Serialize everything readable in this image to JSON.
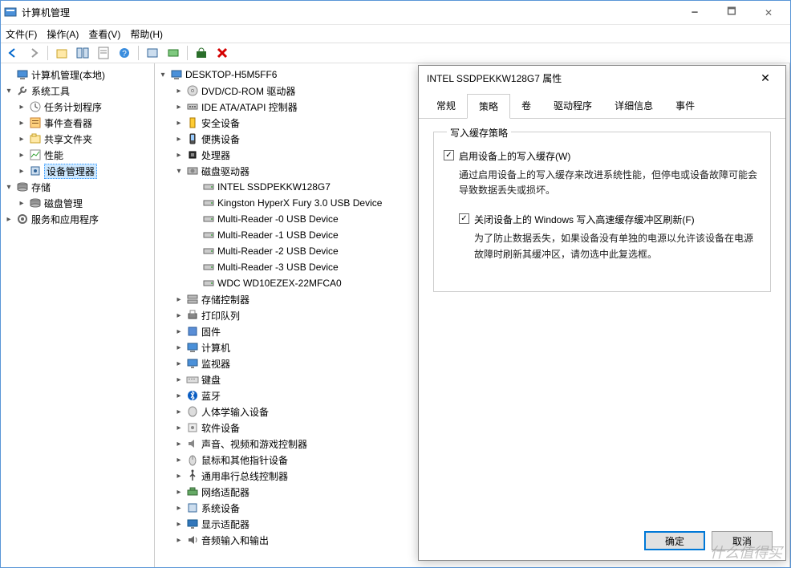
{
  "title": "计算机管理",
  "menu": {
    "file": "文件(F)",
    "operate": "操作(A)",
    "view": "查看(V)",
    "help": "帮助(H)"
  },
  "left_tree": {
    "root": "计算机管理(本地)",
    "groups": [
      {
        "label": "系统工具",
        "expanded": true,
        "children": [
          {
            "label": "任务计划程序",
            "icon": "clock"
          },
          {
            "label": "事件查看器",
            "icon": "event"
          },
          {
            "label": "共享文件夹",
            "icon": "share"
          },
          {
            "label": "性能",
            "icon": "perf"
          },
          {
            "label": "设备管理器",
            "icon": "device",
            "selected": true
          }
        ]
      },
      {
        "label": "存储",
        "expanded": true,
        "children": [
          {
            "label": "磁盘管理",
            "icon": "disk"
          }
        ]
      },
      {
        "label": "服务和应用程序",
        "expanded": false,
        "children": []
      }
    ]
  },
  "center_tree": {
    "root": "DESKTOP-H5M5FF6",
    "categories": [
      {
        "label": "DVD/CD-ROM 驱动器",
        "icon": "dvd",
        "collapsed": true
      },
      {
        "label": "IDE ATA/ATAPI 控制器",
        "icon": "ide",
        "collapsed": true
      },
      {
        "label": "安全设备",
        "icon": "security",
        "collapsed": true
      },
      {
        "label": "便携设备",
        "icon": "portable",
        "collapsed": true
      },
      {
        "label": "处理器",
        "icon": "cpu",
        "collapsed": true
      },
      {
        "label": "磁盘驱动器",
        "icon": "diskdrive",
        "collapsed": false,
        "children": [
          "INTEL SSDPEKKW128G7",
          "Kingston HyperX Fury 3.0 USB Device",
          "Multi-Reader  -0 USB Device",
          "Multi-Reader  -1 USB Device",
          "Multi-Reader  -2 USB Device",
          "Multi-Reader  -3 USB Device",
          "WDC WD10EZEX-22MFCA0"
        ]
      },
      {
        "label": "存储控制器",
        "icon": "storage",
        "collapsed": true
      },
      {
        "label": "打印队列",
        "icon": "printer",
        "collapsed": true
      },
      {
        "label": "固件",
        "icon": "firmware",
        "collapsed": true
      },
      {
        "label": "计算机",
        "icon": "computer",
        "collapsed": true
      },
      {
        "label": "监视器",
        "icon": "monitor",
        "collapsed": true
      },
      {
        "label": "键盘",
        "icon": "keyboard",
        "collapsed": true
      },
      {
        "label": "蓝牙",
        "icon": "bluetooth",
        "collapsed": true
      },
      {
        "label": "人体学输入设备",
        "icon": "hid",
        "collapsed": true
      },
      {
        "label": "软件设备",
        "icon": "software",
        "collapsed": true
      },
      {
        "label": "声音、视频和游戏控制器",
        "icon": "sound",
        "collapsed": true
      },
      {
        "label": "鼠标和其他指针设备",
        "icon": "mouse",
        "collapsed": true
      },
      {
        "label": "通用串行总线控制器",
        "icon": "usb",
        "collapsed": true
      },
      {
        "label": "网络适配器",
        "icon": "network",
        "collapsed": true
      },
      {
        "label": "系统设备",
        "icon": "system",
        "collapsed": true
      },
      {
        "label": "显示适配器",
        "icon": "display",
        "collapsed": true
      },
      {
        "label": "音频输入和输出",
        "icon": "audio",
        "collapsed": true
      }
    ]
  },
  "modal": {
    "title": "INTEL SSDPEKKW128G7 属性",
    "tabs": {
      "general": "常规",
      "policy": "策略",
      "volume": "卷",
      "driver": "驱动程序",
      "detail": "详细信息",
      "event": "事件"
    },
    "active_tab": "policy",
    "fieldset_legend": "写入缓存策略",
    "chk1_label": "启用设备上的写入缓存(W)",
    "chk1_desc": "通过启用设备上的写入缓存来改进系统性能，但停电或设备故障可能会导致数据丢失或损坏。",
    "chk2_label": "关闭设备上的 Windows 写入高速缓存缓冲区刷新(F)",
    "chk2_desc": "为了防止数据丢失，如果设备没有单独的电源以允许该设备在电源故障时刷新其缓冲区，请勿选中此复选框。",
    "btn_ok": "确定",
    "btn_cancel": "取消"
  },
  "watermark": "什么值得买"
}
